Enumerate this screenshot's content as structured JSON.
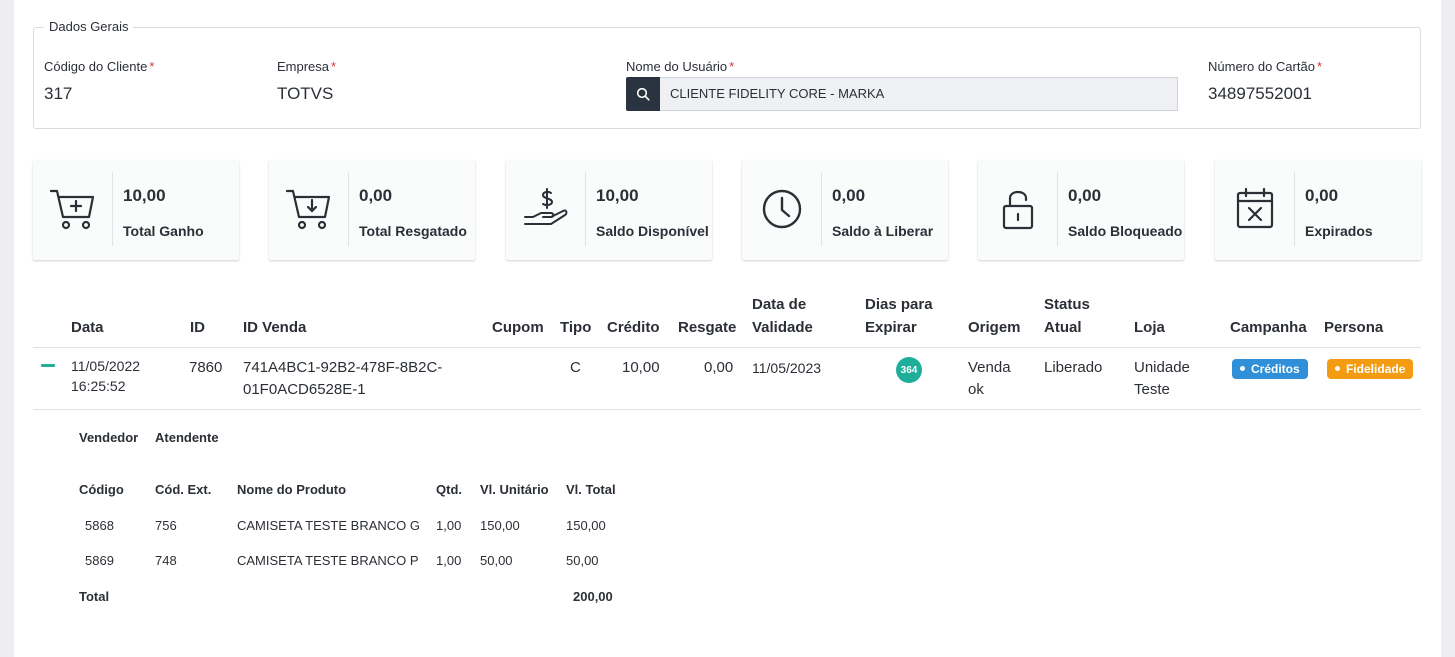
{
  "dados_gerais": {
    "legend": "Dados Gerais",
    "codigo_cliente": {
      "label": "Código do Cliente",
      "value": "317"
    },
    "empresa": {
      "label": "Empresa",
      "value": "TOTVS"
    },
    "nome_usuario": {
      "label": "Nome do Usuário",
      "value": "CLIENTE FIDELITY CORE - MARKA"
    },
    "numero_cartao": {
      "label": "Número do Cartão",
      "value": "34897552001"
    },
    "required_mark": "*"
  },
  "cards": [
    {
      "icon": "cart-plus-icon",
      "value": "10,00",
      "label": "Total Ganho"
    },
    {
      "icon": "cart-download-icon",
      "value": "0,00",
      "label": "Total Resgatado"
    },
    {
      "icon": "hand-dollar-icon",
      "value": "10,00",
      "label": "Saldo Disponível"
    },
    {
      "icon": "clock-icon",
      "value": "0,00",
      "label": "Saldo à Liberar"
    },
    {
      "icon": "lock-open-icon",
      "value": "0,00",
      "label": "Saldo Bloqueado"
    },
    {
      "icon": "calendar-x-icon",
      "value": "0,00",
      "label": "Expirados"
    }
  ],
  "table": {
    "headers": {
      "data": "Data",
      "id": "ID",
      "id_venda": "ID Venda",
      "cupom": "Cupom",
      "tipo": "Tipo",
      "credito": "Crédito",
      "resgate": "Resgate",
      "data_validade_1": "Data de",
      "data_validade_2": "Validade",
      "dias_1": "Dias para",
      "dias_2": "Expirar",
      "origem": "Origem",
      "status_1": "Status",
      "status_2": "Atual",
      "loja": "Loja",
      "campanha": "Campanha",
      "persona": "Persona"
    },
    "row": {
      "data_1": "11/05/2022",
      "data_2": "16:25:52",
      "id": "7860",
      "id_venda_1": "741A4BC1-92B2-478F-8B2C-",
      "id_venda_2": "01F0ACD6528E-1",
      "cupom": "",
      "tipo": "C",
      "credito": "10,00",
      "resgate": "0,00",
      "data_validade": "11/05/2023",
      "dias_expirar": "364",
      "origem_1": "Venda",
      "origem_2": "ok",
      "status": "Liberado",
      "loja_1": "Unidade",
      "loja_2": "Teste",
      "campanha": "Créditos",
      "persona": "Fidelidade"
    },
    "colors": {
      "dias_badge": "#1fae9a",
      "campanha": "#2f8fd8",
      "persona": "#f39c12"
    }
  },
  "detail": {
    "vendedor_label": "Vendedor",
    "atendente_label": "Atendente",
    "headers": {
      "codigo": "Código",
      "cod_ext": "Cód. Ext.",
      "nome": "Nome do Produto",
      "qtd": "Qtd.",
      "vl_unit": "Vl. Unitário",
      "vl_total": "Vl. Total"
    },
    "items": [
      {
        "codigo": "5868",
        "cod_ext": "756",
        "nome": "CAMISETA TESTE BRANCO G",
        "qtd": "1,00",
        "vl_unit": "150,00",
        "vl_total": "150,00"
      },
      {
        "codigo": "5869",
        "cod_ext": "748",
        "nome": "CAMISETA TESTE BRANCO P",
        "qtd": "1,00",
        "vl_unit": "50,00",
        "vl_total": "50,00"
      }
    ],
    "total_label": "Total",
    "total_value": "200,00"
  }
}
